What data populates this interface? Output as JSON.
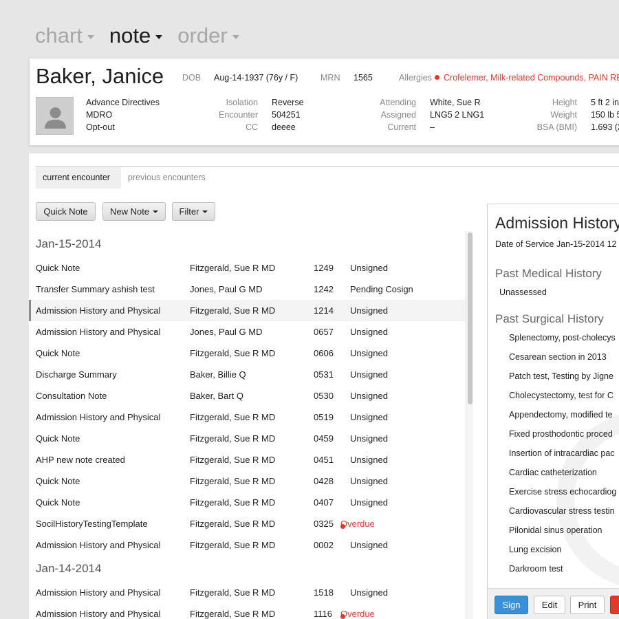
{
  "nav": {
    "tabs": [
      {
        "label": "chart",
        "active": false
      },
      {
        "label": "note",
        "active": true
      },
      {
        "label": "order",
        "active": false
      }
    ]
  },
  "patient": {
    "name": "Baker, Janice",
    "dob_label": "DOB",
    "dob": "Aug-14-1937 (76y / F)",
    "mrn_label": "MRN",
    "mrn": "1565",
    "allergies_label": "Allergies",
    "allergies": "Crofelemer, Milk-related Compounds, PAIN REL",
    "flags": [
      "Advance Directives",
      "MDRO",
      "Opt-out"
    ],
    "isolation_label": "Isolation",
    "isolation": "Reverse",
    "encounter_label": "Encounter",
    "encounter": "504251",
    "cc_label": "CC",
    "cc": "deeee",
    "attending_label": "Attending",
    "attending": "White, Sue R",
    "assigned_label": "Assigned",
    "assigned": "LNG5 2 LNG1",
    "current_label": "Current",
    "current": "–",
    "height_label": "Height",
    "height": "5 ft 2 in",
    "weight_label": "Weight",
    "weight": "150 lb 5",
    "bsa_label": "BSA (BMI)",
    "bsa": "1.693 (2"
  },
  "tabs": {
    "current": "current encounter",
    "previous": "previous encounters"
  },
  "toolbar": {
    "quick_note": "Quick Note",
    "new_note": "New Note",
    "filter": "Filter"
  },
  "groups": [
    {
      "date": "Jan-15-2014",
      "rows": [
        {
          "title": "Quick Note",
          "author": "Fitzgerald, Sue R MD",
          "num": "1249",
          "status": "Unsigned"
        },
        {
          "title": "Transfer Summary ashish test",
          "author": "Jones, Paul G MD",
          "num": "1242",
          "status": "Pending Cosign"
        },
        {
          "title": "Admission History and Physical",
          "author": "Fitzgerald, Sue R MD",
          "num": "1214",
          "status": "Unsigned"
        },
        {
          "title": "Admission History and Physical",
          "author": "Jones, Paul G MD",
          "num": "0657",
          "status": "Unsigned"
        },
        {
          "title": "Quick Note",
          "author": "Fitzgerald, Sue R MD",
          "num": "0606",
          "status": "Unsigned"
        },
        {
          "title": "Discharge Summary",
          "author": "Baker, Billie Q",
          "num": "0531",
          "status": "Unsigned"
        },
        {
          "title": "Consultation Note",
          "author": "Baker, Bart Q",
          "num": "0530",
          "status": "Unsigned"
        },
        {
          "title": "Admission History and Physical",
          "author": "Fitzgerald, Sue R MD",
          "num": "0519",
          "status": "Unsigned"
        },
        {
          "title": "Quick Note",
          "author": "Fitzgerald, Sue R MD",
          "num": "0459",
          "status": "Unsigned"
        },
        {
          "title": "AHP new note created",
          "author": "Fitzgerald, Sue R MD",
          "num": "0451",
          "status": "Unsigned"
        },
        {
          "title": "Quick Note",
          "author": "Fitzgerald, Sue R MD",
          "num": "0428",
          "status": "Unsigned"
        },
        {
          "title": "Quick Note",
          "author": "Fitzgerald, Sue R MD",
          "num": "0407",
          "status": "Unsigned"
        },
        {
          "title": "SocilHistoryTestingTemplate",
          "author": "Fitzgerald, Sue R MD",
          "num": "0325",
          "status": "Overdue"
        },
        {
          "title": "Admission History and Physical",
          "author": "Fitzgerald, Sue R MD",
          "num": "0002",
          "status": "Unsigned"
        }
      ]
    },
    {
      "date": "Jan-14-2014",
      "rows": [
        {
          "title": "Admission History and Physical",
          "author": "Fitzgerald, Sue R MD",
          "num": "1518",
          "status": "Unsigned"
        },
        {
          "title": "Admission History and Physical",
          "author": "Fitzgerald, Sue R MD",
          "num": "1116",
          "status": "Overdue"
        }
      ]
    }
  ],
  "detail": {
    "title": "Admission History",
    "date_of_service": "Date of Service Jan-15-2014 12",
    "pmh_heading": "Past Medical History",
    "pmh_items": [
      "Unassessed"
    ],
    "psh_heading": "Past Surgical History",
    "psh_items": [
      "Splenectomy, post-cholecys",
      "Cesarean section in 2013",
      "Patch test, Testing by Jigne",
      "Cholecystectomy, test for C",
      "Appendectomy, modified te",
      "Fixed prosthodontic proced",
      "Insertion of intracardiac pac",
      "Cardiac catheterization",
      "Exercise stress echocardiog",
      "Cardiovascular stress testin",
      "Pilonidal sinus operation",
      "Lung excision",
      "Darkroom test"
    ],
    "buttons": {
      "sign": "Sign",
      "edit": "Edit",
      "print": "Print",
      "delete": ""
    }
  },
  "colors": {
    "alert_red": "#e03a2f",
    "primary_blue": "#3a8fd9"
  }
}
